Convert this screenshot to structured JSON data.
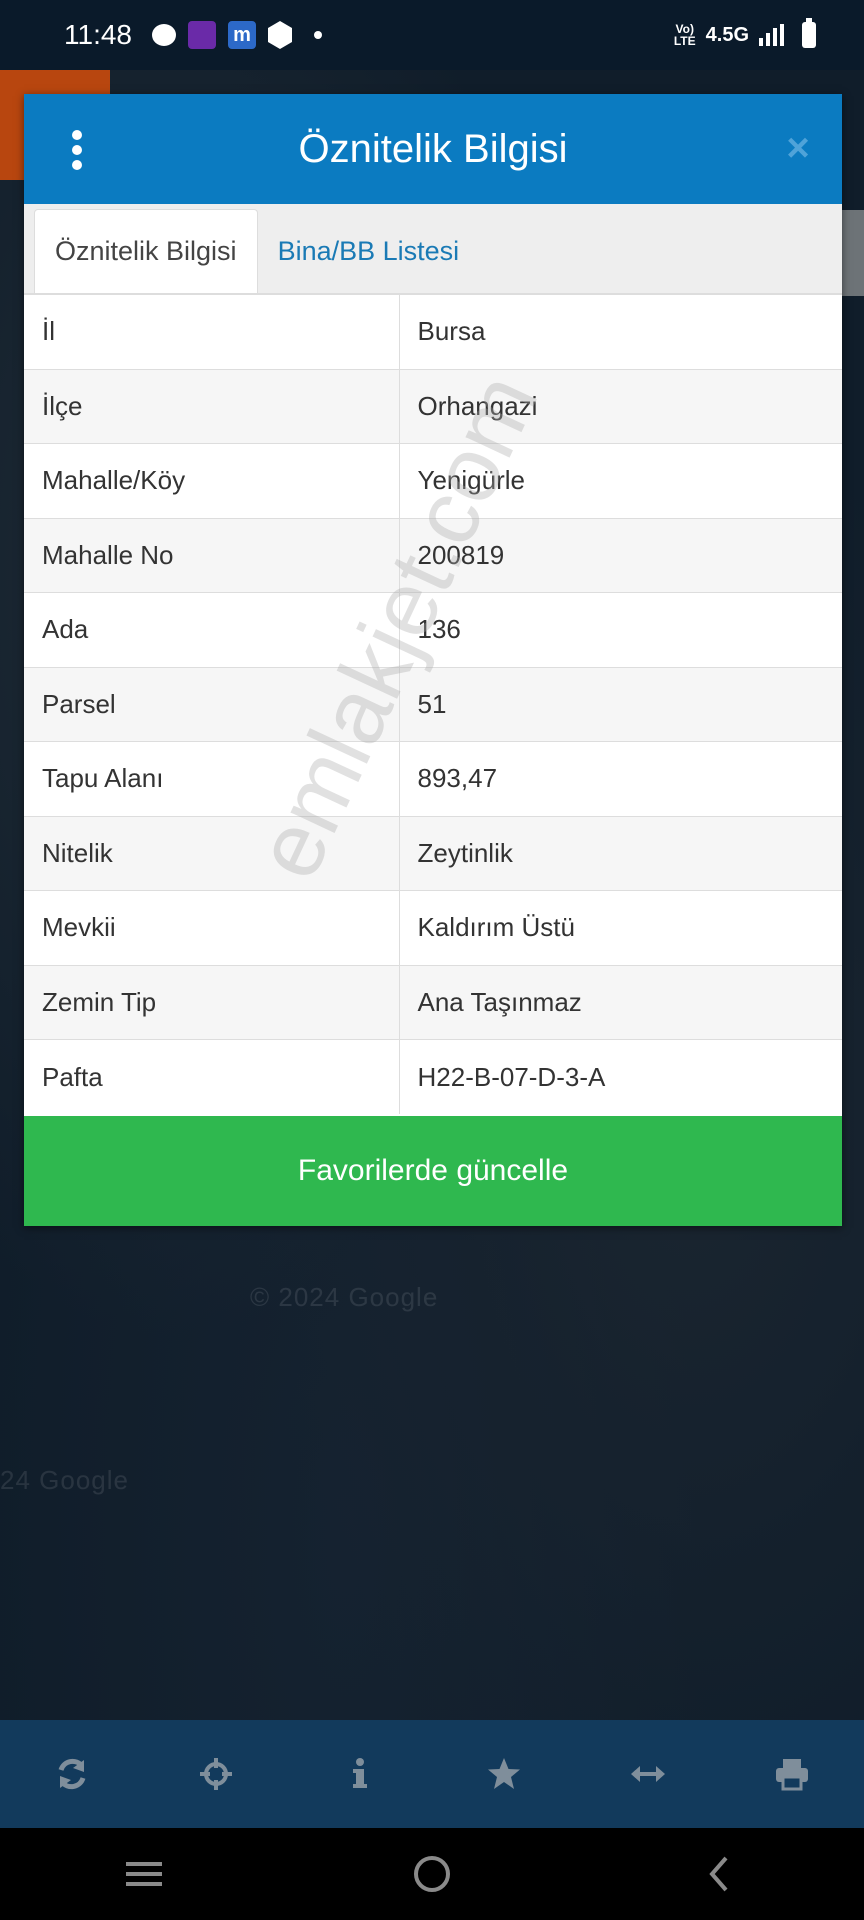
{
  "status_bar": {
    "time": "11:48",
    "network_type": "4.5G",
    "volte_line1": "Vo)",
    "volte_line2": "LTE",
    "notif_m": "m"
  },
  "map": {
    "credit_1": "© 2024 Google",
    "credit_2": "24 Google"
  },
  "modal": {
    "title": "Öznitelik Bilgisi",
    "tabs": [
      {
        "label": "Öznitelik Bilgisi",
        "active": true
      },
      {
        "label": "Bina/BB Listesi",
        "active": false
      }
    ],
    "rows": [
      {
        "key": "İl",
        "value": "Bursa"
      },
      {
        "key": "İlçe",
        "value": "Orhangazi"
      },
      {
        "key": "Mahalle/Köy",
        "value": "Yenigürle"
      },
      {
        "key": "Mahalle No",
        "value": "200819"
      },
      {
        "key": "Ada",
        "value": "136"
      },
      {
        "key": "Parsel",
        "value": "51"
      },
      {
        "key": "Tapu Alanı",
        "value": "893,47"
      },
      {
        "key": "Nitelik",
        "value": "Zeytinlik"
      },
      {
        "key": "Mevkii",
        "value": "Kaldırım Üstü"
      },
      {
        "key": "Zemin Tip",
        "value": "Ana Taşınmaz"
      },
      {
        "key": "Pafta",
        "value": "H22-B-07-D-3-A"
      }
    ],
    "favorite_button": "Favorilerde güncelle",
    "close_symbol": "×"
  },
  "watermark": "emlakjet.com",
  "colors": {
    "header": "#0b7bc1",
    "button": "#2fb84f",
    "toolbar": "#123a5c",
    "tab_link": "#1a7ab5"
  },
  "toolbar_icons": [
    "refresh-icon",
    "crosshair-icon",
    "info-icon",
    "star-icon",
    "measure-icon",
    "print-icon"
  ],
  "nav_icons": [
    "recent-apps-icon",
    "home-icon",
    "back-icon"
  ]
}
